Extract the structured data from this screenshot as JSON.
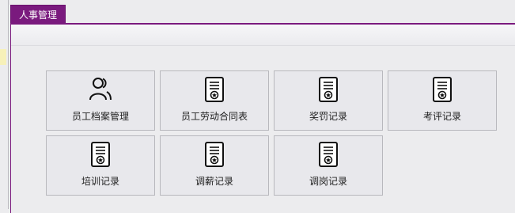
{
  "tab": {
    "label": "人事管理"
  },
  "tiles": [
    {
      "label": "员工档案管理",
      "icon": "people-icon"
    },
    {
      "label": "员工劳动合同表",
      "icon": "certificate-icon"
    },
    {
      "label": "奖罚记录",
      "icon": "certificate-icon"
    },
    {
      "label": "考评记录",
      "icon": "certificate-icon"
    },
    {
      "label": "培训记录",
      "icon": "certificate-icon"
    },
    {
      "label": "调薪记录",
      "icon": "certificate-icon"
    },
    {
      "label": "调岗记录",
      "icon": "certificate-icon"
    }
  ],
  "colors": {
    "accent": "#7a1a7e"
  }
}
